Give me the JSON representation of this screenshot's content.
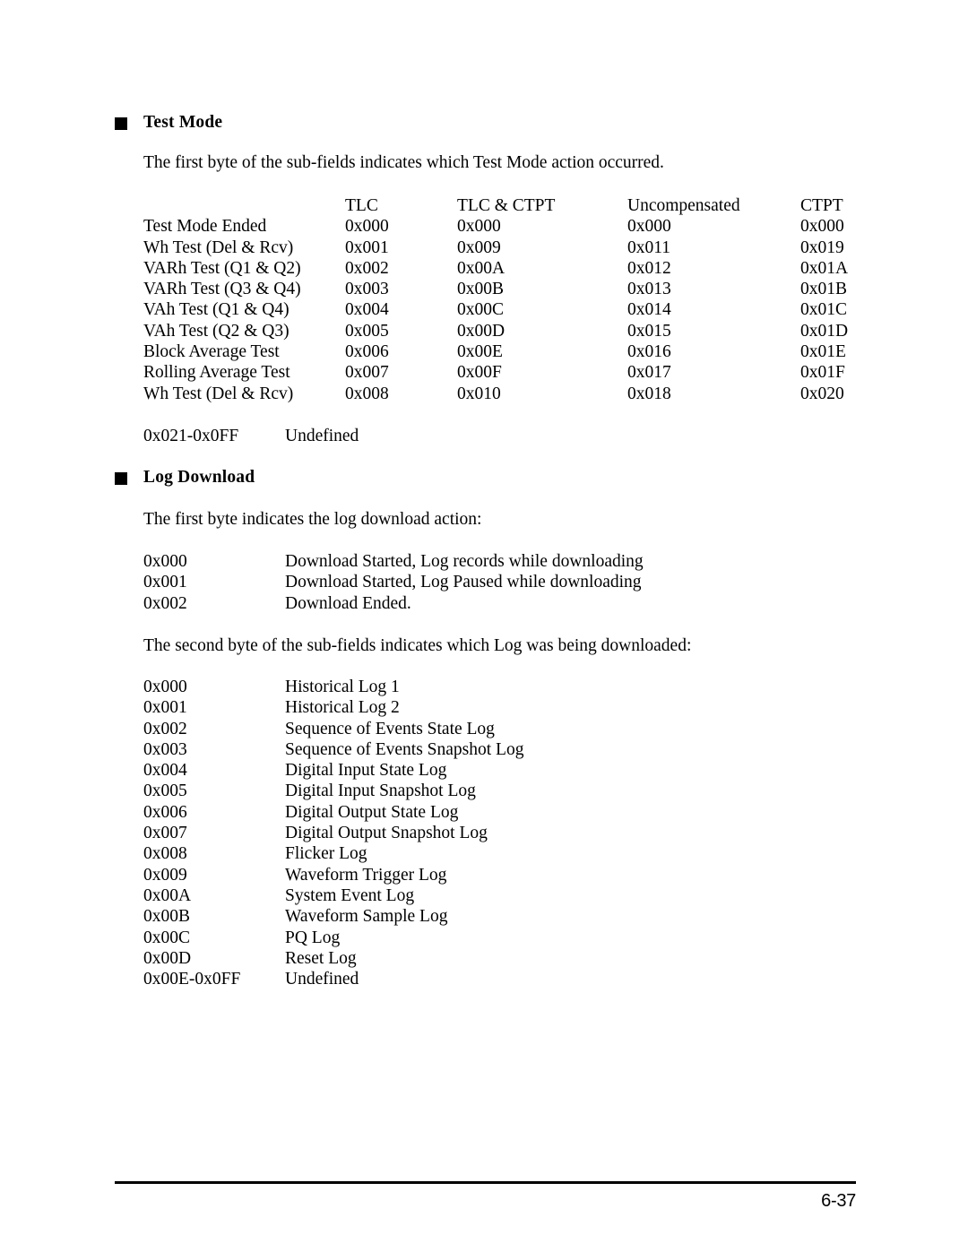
{
  "sections": {
    "test_mode": {
      "heading": "Test Mode",
      "intro": "The first byte of the sub-fields indicates which Test Mode action occurred.",
      "table": {
        "headers": [
          "",
          "TLC",
          "TLC & CTPT",
          "Uncompensated",
          "CTPT"
        ],
        "rows": [
          [
            "Test Mode Ended",
            "0x000",
            "0x000",
            "0x000",
            "0x000"
          ],
          [
            "Wh Test (Del & Rcv)",
            "0x001",
            "0x009",
            "0x011",
            "0x019"
          ],
          [
            "VARh Test (Q1 & Q2)",
            "0x002",
            "0x00A",
            "0x012",
            "0x01A"
          ],
          [
            "VARh Test (Q3 & Q4)",
            "0x003",
            "0x00B",
            "0x013",
            "0x01B"
          ],
          [
            "VAh Test (Q1 & Q4)",
            "0x004",
            "0x00C",
            "0x014",
            "0x01C"
          ],
          [
            "VAh Test (Q2 & Q3)",
            "0x005",
            "0x00D",
            "0x015",
            "0x01D"
          ],
          [
            "Block Average Test",
            "0x006",
            "0x00E",
            "0x016",
            "0x01E"
          ],
          [
            "Rolling Average Test",
            "0x007",
            "0x00F",
            "0x017",
            "0x01F"
          ],
          [
            "Wh Test (Del & Rcv)",
            "0x008",
            "0x010",
            "0x018",
            "0x020"
          ]
        ]
      },
      "undefined_range": {
        "code": "0x021-0x0FF",
        "desc": "Undefined"
      }
    },
    "log_download": {
      "heading": "Log Download",
      "intro_first_byte": "The first byte indicates the log download action:",
      "first_byte_items": [
        {
          "code": "0x000",
          "desc": "Download Started, Log records while downloading"
        },
        {
          "code": "0x001",
          "desc": "Download Started, Log Paused while downloading"
        },
        {
          "code": "0x002",
          "desc": "Download Ended."
        }
      ],
      "intro_second_byte": "The second byte of the sub-fields indicates which Log was being downloaded:",
      "second_byte_items": [
        {
          "code": "0x000",
          "desc": "Historical Log 1"
        },
        {
          "code": "0x001",
          "desc": "Historical Log 2"
        },
        {
          "code": "0x002",
          "desc": "Sequence of Events State Log"
        },
        {
          "code": "0x003",
          "desc": "Sequence of Events Snapshot Log"
        },
        {
          "code": "0x004",
          "desc": "Digital Input State Log"
        },
        {
          "code": "0x005",
          "desc": "Digital Input Snapshot Log"
        },
        {
          "code": "0x006",
          "desc": "Digital Output State Log"
        },
        {
          "code": "0x007",
          "desc": "Digital Output Snapshot Log"
        },
        {
          "code": "0x008",
          "desc": "Flicker Log"
        },
        {
          "code": "0x009",
          "desc": "Waveform Trigger Log"
        },
        {
          "code": "0x00A",
          "desc": "System Event Log"
        },
        {
          "code": "0x00B",
          "desc": "Waveform Sample Log"
        },
        {
          "code": "0x00C",
          "desc": "PQ Log"
        },
        {
          "code": "0x00D",
          "desc": "Reset Log"
        },
        {
          "code": "0x00E-0x0FF",
          "desc": "Undefined"
        }
      ]
    }
  },
  "footer": {
    "page_number": "6-37"
  }
}
